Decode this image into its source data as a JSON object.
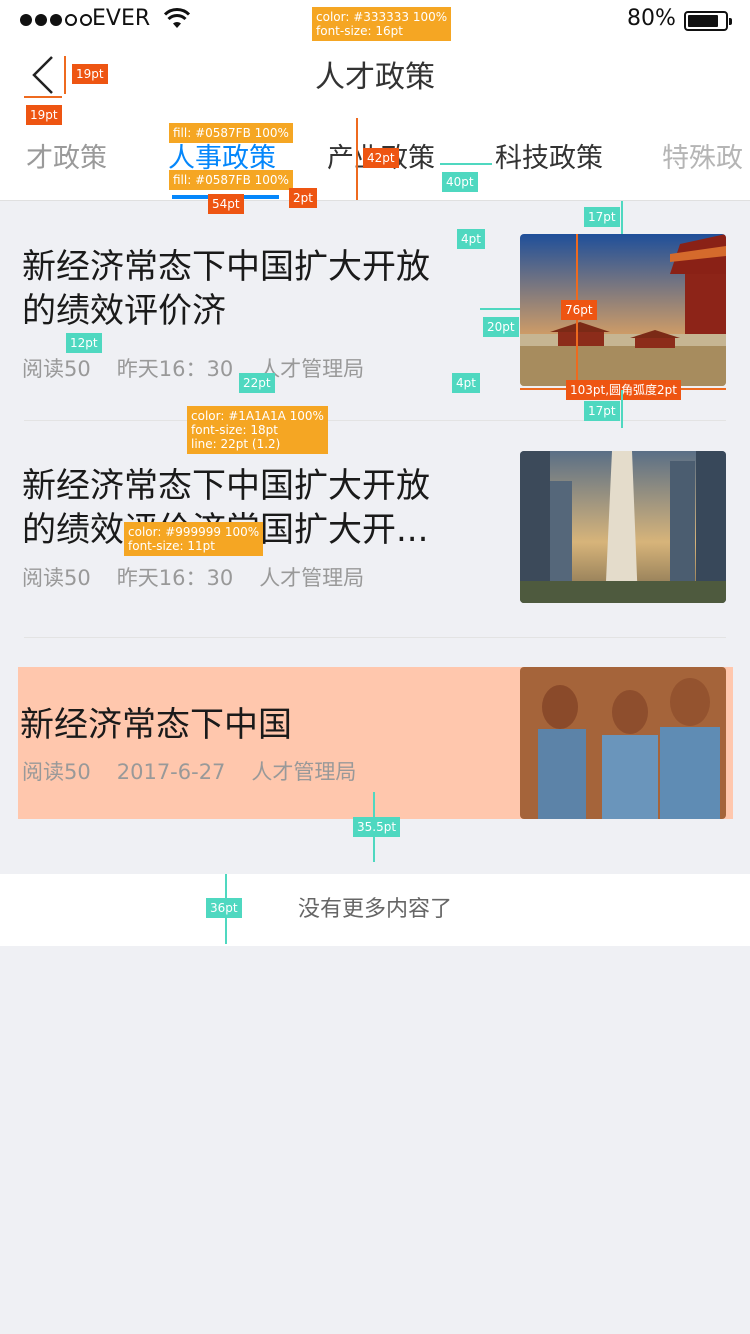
{
  "status_bar": {
    "carrier": "EVER",
    "battery_pct": "80%",
    "battery_level": 0.8
  },
  "nav": {
    "title": "人才政策"
  },
  "tabs": [
    {
      "label": "才政策"
    },
    {
      "label": "人事政策",
      "active": true
    },
    {
      "label": "产业政策"
    },
    {
      "label": "科技政策"
    },
    {
      "label": "特殊政"
    }
  ],
  "articles": [
    {
      "title": "新经济常态下中国扩大开放的绩效评价济",
      "reads": "阅读50",
      "time": "昨天16：30",
      "source": "人才管理局",
      "image": "forbidden-city-photo"
    },
    {
      "title": "新经济常态下中国扩大开放的绩效评价济常国扩大开...",
      "reads": "阅读50",
      "time": "昨天16：30",
      "source": "人才管理局",
      "image": "city-skyline-photo"
    },
    {
      "title": "新经济常态下中国",
      "reads": "阅读50",
      "time": "2017-6-27",
      "source": "人才管理局",
      "image": "basketball-players-photo",
      "highlight": "#ffc7ad"
    }
  ],
  "footer": {
    "no_more": "没有更多内容了"
  },
  "colors": {
    "accent": "#0587FB",
    "title": "#1A1A1A",
    "meta": "#999999",
    "nav_title": "#333333"
  },
  "annotations": {
    "nav_title_spec": [
      "color: #333333 100%",
      "font-size: 16pt"
    ],
    "back_h": "19pt",
    "back_w": "19pt",
    "tab_fill_1": "fill: #0587FB 100%",
    "tab_fill_2": "fill: #0587FB 100%",
    "underline_w": "54pt",
    "underline_h": "2pt",
    "tab_height": "42pt",
    "tab_gap": "40pt",
    "img_top": "17pt",
    "title_gap": "4pt",
    "img_height": "76pt",
    "text_img_gap": "20pt",
    "meta_left": "12pt",
    "meta_gap": "22pt",
    "meta_bottom": "4pt",
    "img_size": "103pt,圆角弧度2pt",
    "img_bottom": "17pt",
    "title_spec": [
      "color: #1A1A1A 100%",
      "font-size: 18pt",
      "line: 22pt (1.2)"
    ],
    "meta_spec": [
      "color: #999999 100%",
      "font-size: 11pt"
    ],
    "card_bottom": "35.5pt",
    "footer_h": "36pt"
  }
}
